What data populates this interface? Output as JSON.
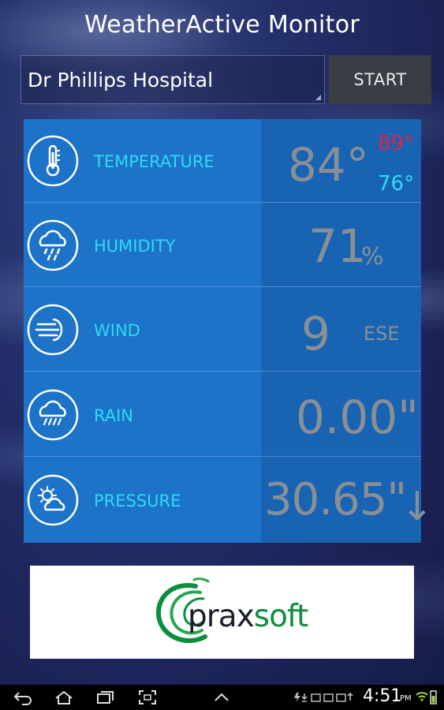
{
  "app": {
    "title": "WeatherActive Monitor"
  },
  "location": {
    "value": "Dr Phillips Hospital"
  },
  "start_button": {
    "label": "START"
  },
  "readings": {
    "temperature": {
      "label": "TEMPERATURE",
      "value": "84°",
      "high": "89°",
      "low": "76°"
    },
    "humidity": {
      "label": "HUMIDITY",
      "value": "71",
      "unit": "%"
    },
    "wind": {
      "label": "WIND",
      "value": "9",
      "direction": "ESE"
    },
    "rain": {
      "label": "RAIN",
      "value": "0.00\""
    },
    "pressure": {
      "label": "PRESSURE",
      "value": "30.65\"",
      "trend": "↓"
    }
  },
  "ad": {
    "logo_part1": "prax",
    "logo_part2": "soft"
  },
  "status_bar": {
    "time": "4:51",
    "ampm": "PM"
  },
  "colors": {
    "label_accent": "#2fd9f4",
    "high_temp": "#e0244a",
    "low_temp": "#2fd9f4",
    "panel_bg": "#1d73c8",
    "value_text": "#8a8f96"
  },
  "icons": [
    "thermometer-icon",
    "humidity-rain-icon",
    "wind-icon",
    "rain-cloud-icon",
    "sun-cloud-icon",
    "back-icon",
    "home-icon",
    "recent-apps-icon",
    "screenshot-icon",
    "up-arrow-icon"
  ]
}
